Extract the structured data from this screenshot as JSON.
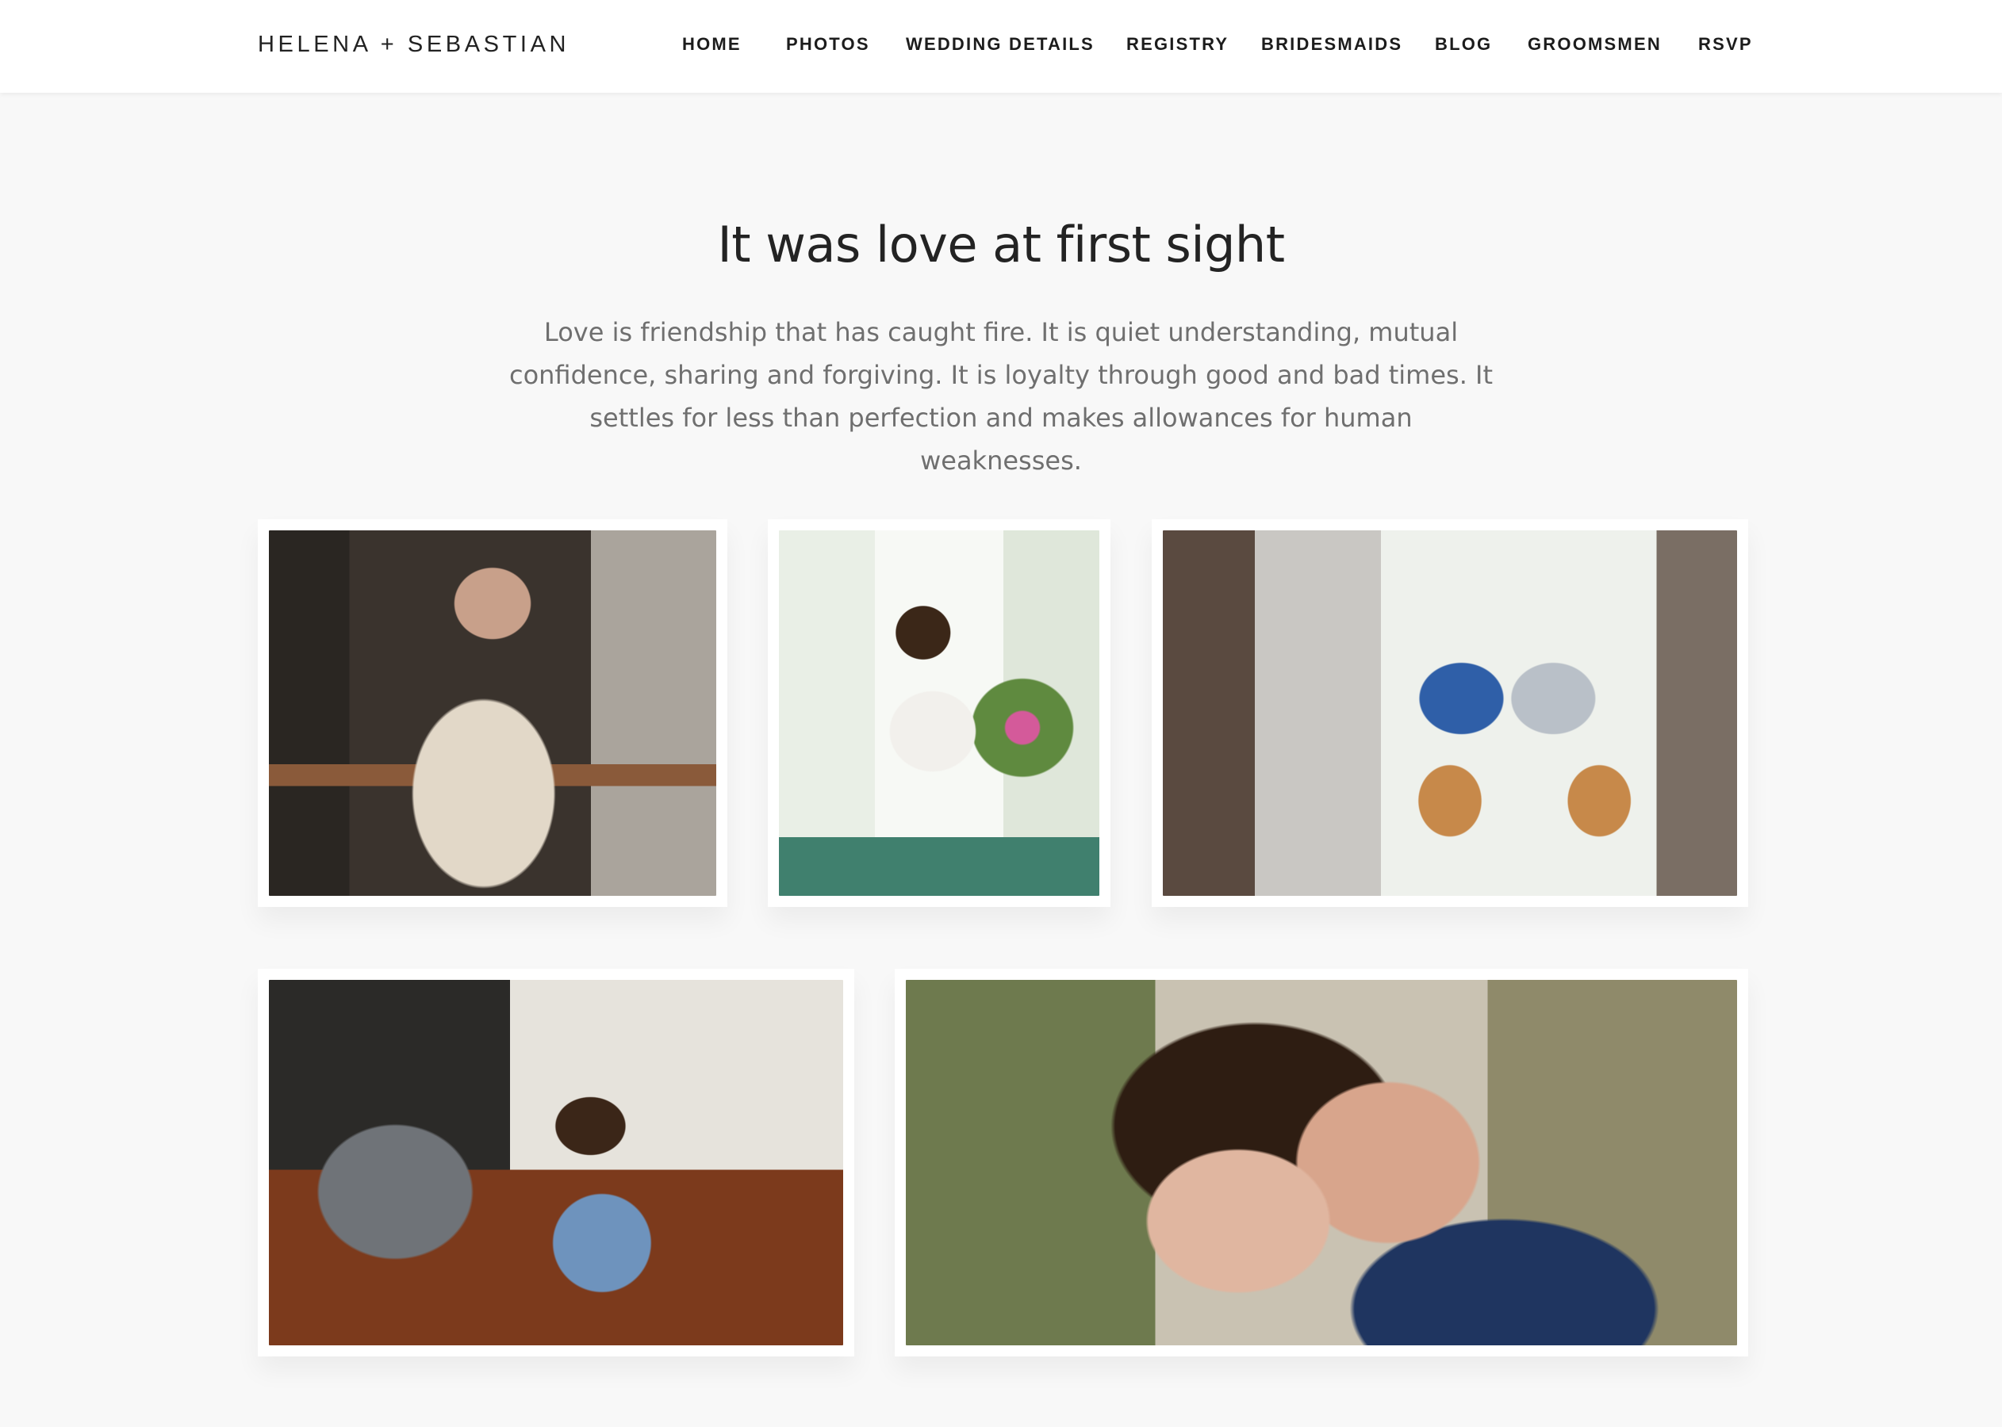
{
  "header": {
    "brand": "HELENA + SEBASTIAN",
    "nav": [
      {
        "label": "HOME"
      },
      {
        "label": "PHOTOS"
      },
      {
        "label": "WEDDING DETAILS"
      },
      {
        "label": "REGISTRY"
      },
      {
        "label": "BRIDESMAIDS"
      },
      {
        "label": "BLOG"
      },
      {
        "label": "GROOMSMEN"
      },
      {
        "label": "RSVP"
      }
    ]
  },
  "main": {
    "title": "It was love at first sight",
    "intro": "Love is friendship that has caught fire. It is quiet understanding, mutual confidence, sharing and forgiving. It is loyalty through good and bad times. It settles for less than perfection and makes allowances for human weaknesses."
  },
  "gallery": {
    "photos": [
      {
        "name": "photo-man-cooking"
      },
      {
        "name": "photo-woman-flowers"
      },
      {
        "name": "photo-couple-at-window"
      },
      {
        "name": "photo-couple-cafe"
      },
      {
        "name": "photo-couple-smiling"
      }
    ]
  }
}
